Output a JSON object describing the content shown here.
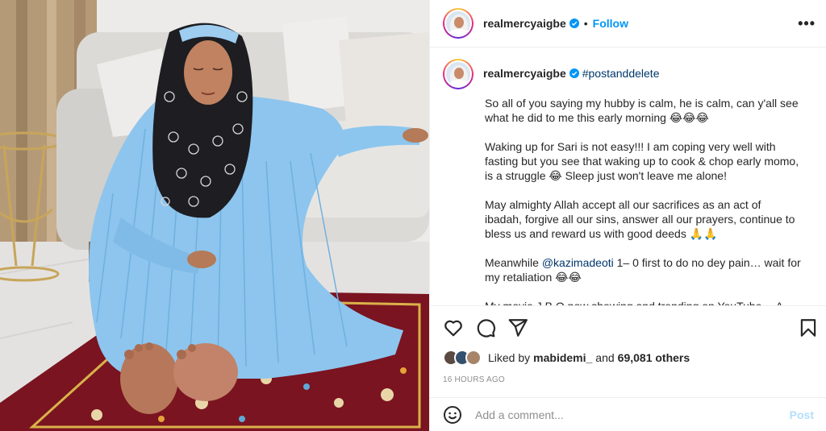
{
  "post": {
    "username": "realmercyaigbe",
    "follow_label": "Follow",
    "dot": "•",
    "more_label": "•••"
  },
  "caption": {
    "username": "realmercyaigbe",
    "hashtag": "#postanddelete",
    "p1": "So all of you saying my hubby is calm, he is calm, can y'all see what he did to me this early morning 😂😂😂",
    "p2": "Waking up for Sari is not easy!!! I am coping very well with fasting but you see that waking up to cook & chop early momo, is a struggle 😂 Sleep just won't leave me alone!",
    "p3": "May almighty Allah accept all our sacrifices as an act of ibadah, forgive all our sins, answer all our prayers, continue to bless us and reward us with good deeds 🙏🙏",
    "p4_prefix": "Meanwhile ",
    "p4_mention": "@kazimadeoti",
    "p4_suffix": " 1– 0 first to do no dey pain… wait for my retaliation 😂😂",
    "p5": "My movie J.B.O now showing and trending on YouTube… A must"
  },
  "likes": {
    "prefix": "Liked by",
    "user": "mabidemi_",
    "and": "and",
    "count": "69,081 others"
  },
  "timestamp": "16 HOURS AGO",
  "comment": {
    "placeholder": "Add a comment...",
    "post_label": "Post"
  },
  "icons": {
    "like": "heart-icon",
    "comment": "comment-icon",
    "share": "paper-plane-icon",
    "save": "bookmark-icon",
    "emoji": "smiley-icon",
    "verified": "verified-badge-icon"
  },
  "colors": {
    "accent": "#0095f6",
    "link": "#00376b",
    "muted": "#8e8e8e",
    "post_disabled": "#b2dffc"
  }
}
